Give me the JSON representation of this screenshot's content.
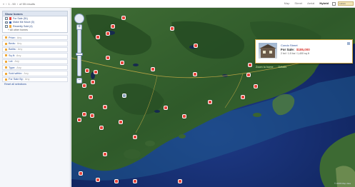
{
  "pager": {
    "first": "«",
    "prev": "‹",
    "range": "1 - 50",
    "next": "›",
    "count": "of 55 results"
  },
  "map_types": {
    "map": "Map",
    "street": "Street",
    "aerial": "Aerial",
    "hybrid": "Hybrid",
    "labels": "Labels"
  },
  "sidebar": {
    "legend_title": "Show homes",
    "legend": [
      {
        "label": "For Sale (51)",
        "color": "#e9463c"
      },
      {
        "label": "Make Me Move (0)",
        "color": "#3a62b3"
      },
      {
        "label": "Recently Sold (4)",
        "color": "#f0a93a"
      }
    ],
    "other_homes": "+ All other homes",
    "filters": [
      {
        "label": "Price:",
        "cond": "Any"
      },
      {
        "label": "Beds:",
        "cond": "Any"
      },
      {
        "label": "Baths:",
        "cond": "Any"
      },
      {
        "label": "Sq ft:",
        "cond": "Any"
      },
      {
        "label": "Lot:",
        "cond": "Any"
      },
      {
        "label": "Type:",
        "cond": "Any"
      },
      {
        "label": "Sold within:",
        "cond": "Any"
      },
      {
        "label": "For Sale By:",
        "cond": "Any"
      }
    ],
    "reset": "Reset all selections"
  },
  "info_window": {
    "title": "Condo Street",
    "status": "For Sale:",
    "price": "$185,000",
    "details": "2 bd / 1.5 ba / 1,400 sq ft",
    "link_zoom": "Zoom to home",
    "link_details": "Details"
  },
  "copyright": "© 2008 Map data"
}
